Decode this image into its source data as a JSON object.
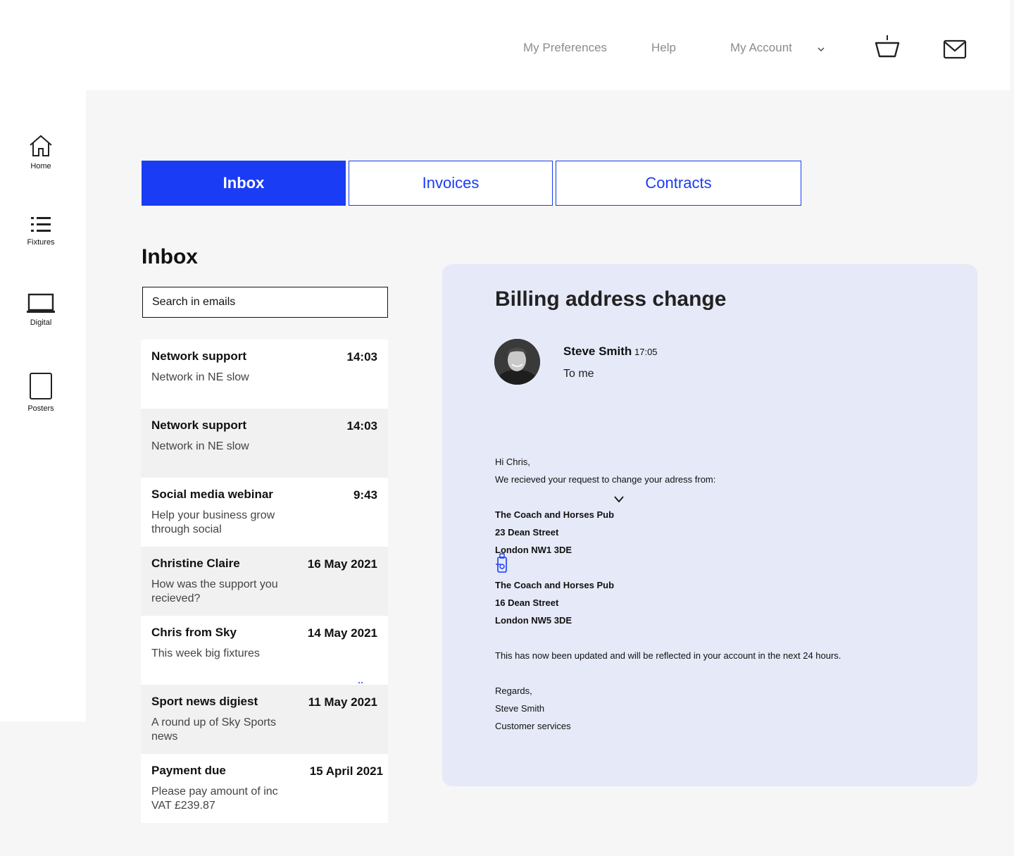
{
  "topnav": {
    "preferences": "My Preferences",
    "help": "Help",
    "account": "My Account",
    "icons": [
      "chevron-down-icon",
      "basket-icon",
      "mail-icon"
    ]
  },
  "sidebar": {
    "items": [
      {
        "label": "Home",
        "icon": "home-icon"
      },
      {
        "label": "Fixtures",
        "icon": "list-icon"
      },
      {
        "label": "Digital",
        "icon": "laptop-icon"
      },
      {
        "label": "Posters",
        "icon": "poster-icon"
      }
    ]
  },
  "tabs": [
    {
      "label": "Inbox",
      "active": true
    },
    {
      "label": "Invoices",
      "active": false
    },
    {
      "label": "Contracts",
      "active": false
    }
  ],
  "inbox": {
    "title": "Inbox",
    "search_placeholder": "Search in emails",
    "emails": [
      {
        "sender": "Network support",
        "time": "14:03",
        "preview": "Network in NE slow"
      },
      {
        "sender": "Network support",
        "time": "14:03",
        "preview": "Network in NE slow"
      },
      {
        "sender": "Social media webinar",
        "time": "9:43",
        "preview": "Help your business grow through social"
      },
      {
        "sender": "Christine Claire",
        "time": "16 May 2021",
        "preview": "How was the support you recieved?"
      },
      {
        "sender": "Chris from Sky",
        "time": "14 May 2021",
        "preview": "This week big fixtures"
      },
      {
        "sender": "Sport news digiest",
        "time": "11 May 2021",
        "preview": "A round up of Sky Sports news"
      },
      {
        "sender": "Payment due",
        "time": "15 April 2021",
        "preview": "Please pay amount of inc VAT £239.87"
      }
    ]
  },
  "message": {
    "subject": "Billing address change",
    "from": "Steve Smith",
    "time": "17:05",
    "to": "To me",
    "greeting": "Hi Chris,",
    "intro": "We recieved your request to change your adress from:",
    "old_address": [
      "The Coach and Horses Pub",
      "23 Dean Street",
      "London NW1 3DE"
    ],
    "new_address": [
      "The Coach and Horses Pub",
      "16 Dean Street",
      "London NW5 3DE"
    ],
    "body": "This has now been updated and will be reflected in your account in the next 24 hours.",
    "signoff": [
      "Regards,",
      "Steve Smith",
      "Customer services"
    ]
  },
  "colors": {
    "accent": "#1a3cf5",
    "pane": "#e6e9f7",
    "page": "#f6f6f6"
  }
}
